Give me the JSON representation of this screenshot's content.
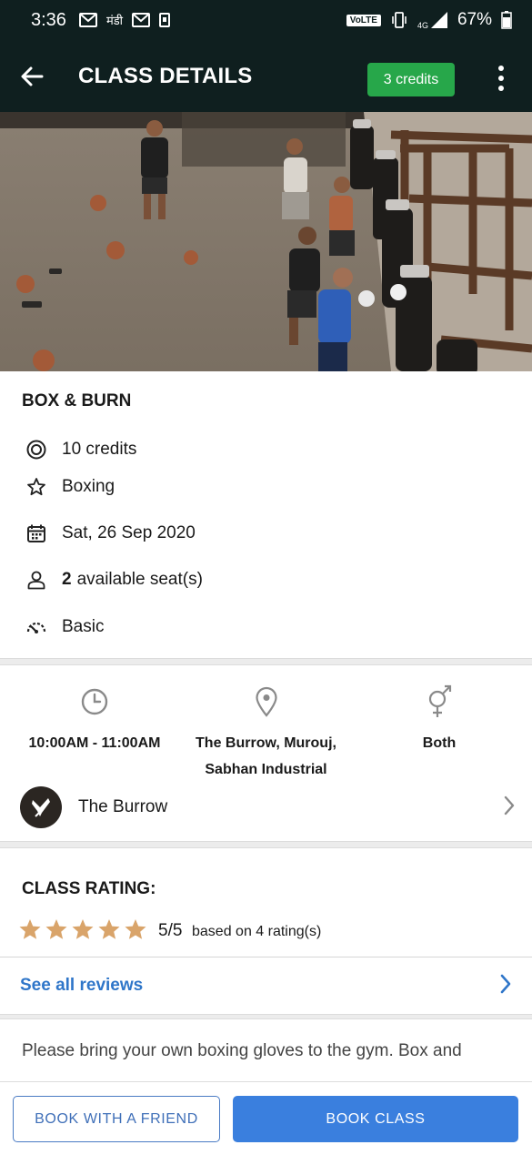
{
  "status_bar": {
    "time": "3:36",
    "icons_left": [
      "mail-icon",
      "mandi-app-icon",
      "mail-icon",
      "sim-icon"
    ],
    "mandi_text": "मंडी",
    "volte_label": "VoLTE",
    "network": "4G",
    "battery_percent": "67%"
  },
  "app_bar": {
    "title": "CLASS DETAILS",
    "credits_chip": "3 credits",
    "back_icon": "arrow-left-icon",
    "menu_icon": "more-vertical-icon"
  },
  "class": {
    "name": "BOX & BURN",
    "credits": "10 credits",
    "category": "Boxing",
    "date": "Sat, 26 Sep 2020",
    "seats_count": "2",
    "seats_label": "available seat(s)",
    "level": "Basic"
  },
  "meta": {
    "time": "10:00AM - 11:00AM",
    "location_line1": "The Burrow, Murouj,",
    "location_line2": "Sabhan Industrial",
    "gender": "Both"
  },
  "venue": {
    "name": "The Burrow"
  },
  "rating": {
    "title": "CLASS RATING:",
    "stars": 5,
    "value": "5/5",
    "basis": "based on 4 rating(s)",
    "star_color": "#d9a46a"
  },
  "reviews": {
    "link_label": "See all reviews"
  },
  "description": {
    "visible_text": "Please bring your own boxing gloves to the gym. Box and"
  },
  "actions": {
    "friend_label": "BOOK WITH A FRIEND",
    "book_label": "BOOK CLASS"
  },
  "colors": {
    "app_bar_bg": "#0f1f1f",
    "credits_green": "#27a74a",
    "link_blue": "#2f76c9",
    "primary_button": "#3a7fde"
  }
}
